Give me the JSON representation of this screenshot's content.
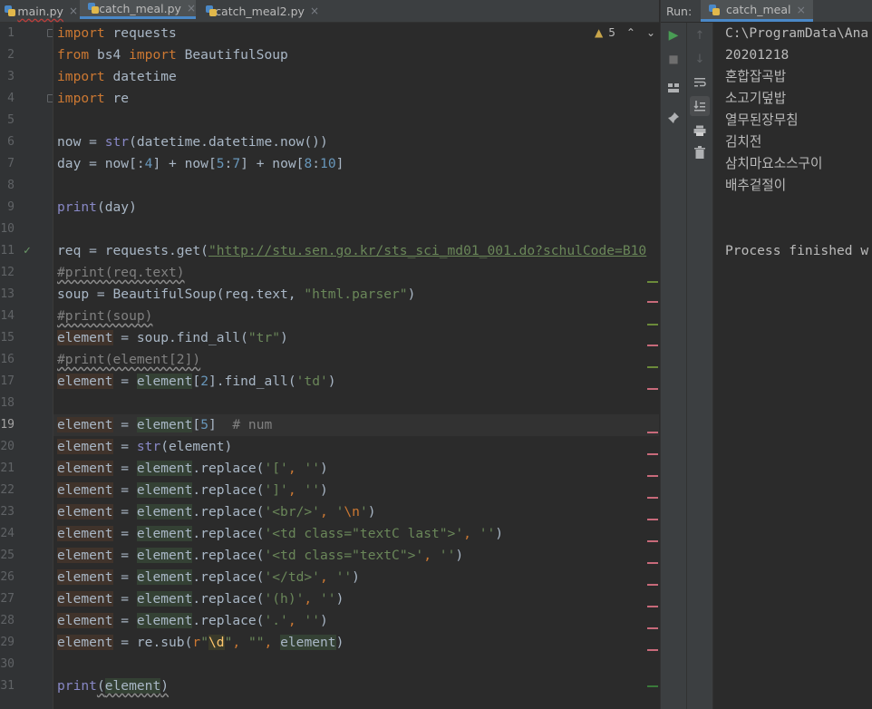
{
  "editor": {
    "tabs": [
      {
        "label": "main.py",
        "close": "×"
      },
      {
        "label": "catch_meal.py",
        "close": "×"
      },
      {
        "label": "catch_meal2.py",
        "close": "×"
      }
    ],
    "warnings_count": "5",
    "line_numbers": [
      "1",
      "2",
      "3",
      "4",
      "5",
      "6",
      "7",
      "8",
      "9",
      "10",
      "11",
      "12",
      "13",
      "14",
      "15",
      "16",
      "17",
      "18",
      "19",
      "20",
      "21",
      "22",
      "23",
      "24",
      "25",
      "26",
      "27",
      "28",
      "29",
      "30",
      "31"
    ],
    "code": {
      "l1_kw": "import",
      "l1_rest": " requests",
      "l2_kw1": "from",
      "l2_mid": " bs4 ",
      "l2_kw2": "import",
      "l2_rest": " BeautifulSoup",
      "l3_kw": "import",
      "l3_rest": " datetime",
      "l4_kw": "import",
      "l4_rest": " re",
      "l6_a": "now = ",
      "l6_fn": "str",
      "l6_b": "(datetime.datetime.now())",
      "l7_a": "day = now[:",
      "l7_n1": "4",
      "l7_b": "] + now[",
      "l7_n2": "5",
      "l7_c": ":",
      "l7_n3": "7",
      "l7_d": "] + now[",
      "l7_n4": "8",
      "l7_e": ":",
      "l7_n5": "10",
      "l7_f": "]",
      "l9_fn": "print",
      "l9_rest": "(day)",
      "l11_a": "req = requests.get(",
      "l11_url": "\"http://stu.sen.go.kr/sts_sci_md01_001.do?schulCode=B10",
      "l12": "#print(req.text)",
      "l13_a": "soup = BeautifulSoup(req.text, ",
      "l13_s": "\"html.parser\"",
      "l13_b": ")",
      "l14": "#print(soup)",
      "l15_a": "element",
      "l15_b": " = soup.find_all(",
      "l15_s": "\"tr\"",
      "l15_c": ")",
      "l16": "#print(element[2])",
      "l17_a": "element",
      "l17_b": " = ",
      "l17_c": "element",
      "l17_d": "[",
      "l17_n": "2",
      "l17_e": "].find_all(",
      "l17_s": "'td'",
      "l17_f": ")",
      "l19_a": "element",
      "l19_b": " = ",
      "l19_c": "element",
      "l19_d": "[",
      "l19_n": "5",
      "l19_e": "]  ",
      "l19_cm": "# num",
      "l20_a": "element",
      "l20_b": " = ",
      "l20_fn": "str",
      "l20_c": "(element)",
      "rep_a": "element",
      "rep_eq": " = ",
      "rep_c": "element",
      "rep_m": ".replace(",
      "l21_s1": "'['",
      "l21_s2": "''",
      "l22_s1": "']'",
      "l22_s2": "''",
      "l23_s1": "'<br/>'",
      "l23_s2a": "'",
      "l23_esc": "\\n",
      "l23_s2b": "'",
      "l24_s1": "'<td class=\"textC last\">'",
      "l24_s2": "''",
      "l25_s1": "'<td class=\"textC\">'",
      "l25_s2": "''",
      "l26_s1": "'</td>'",
      "l26_s2": "''",
      "l27_s1": "'(h)'",
      "l27_s2": "''",
      "l28_s1": "'.'",
      "l28_s2": "''",
      "comma": ", ",
      "close": ")",
      "l29_a": "element",
      "l29_b": " = re.sub(",
      "l29_r": "r",
      "l29_q1": "\"",
      "l29_esc": "\\d",
      "l29_q2": "\"",
      "l29_c": ", ",
      "l29_s2": "\"\"",
      "l29_d": ", ",
      "l29_e": "element",
      "l29_f": ")",
      "l31_fn": "print",
      "l31_b": "(",
      "l31_c": "element",
      "l31_d": ")"
    }
  },
  "run": {
    "label": "Run:",
    "tab_label": "catch_meal",
    "tab_close": "×",
    "output": [
      "C:\\ProgramData\\Ana",
      "20201218",
      "혼합잡곡밥",
      "소고기덮밥",
      "열무된장무침",
      "김치전",
      "삼치마요소스구이",
      "배추겉절이",
      "",
      "",
      "Process finished w"
    ]
  },
  "colors": {
    "background": "#2b2b2b",
    "keyword": "#cc7832",
    "string": "#6a8759",
    "number": "#6897bb",
    "comment": "#808080",
    "accent": "#4a88c7"
  }
}
